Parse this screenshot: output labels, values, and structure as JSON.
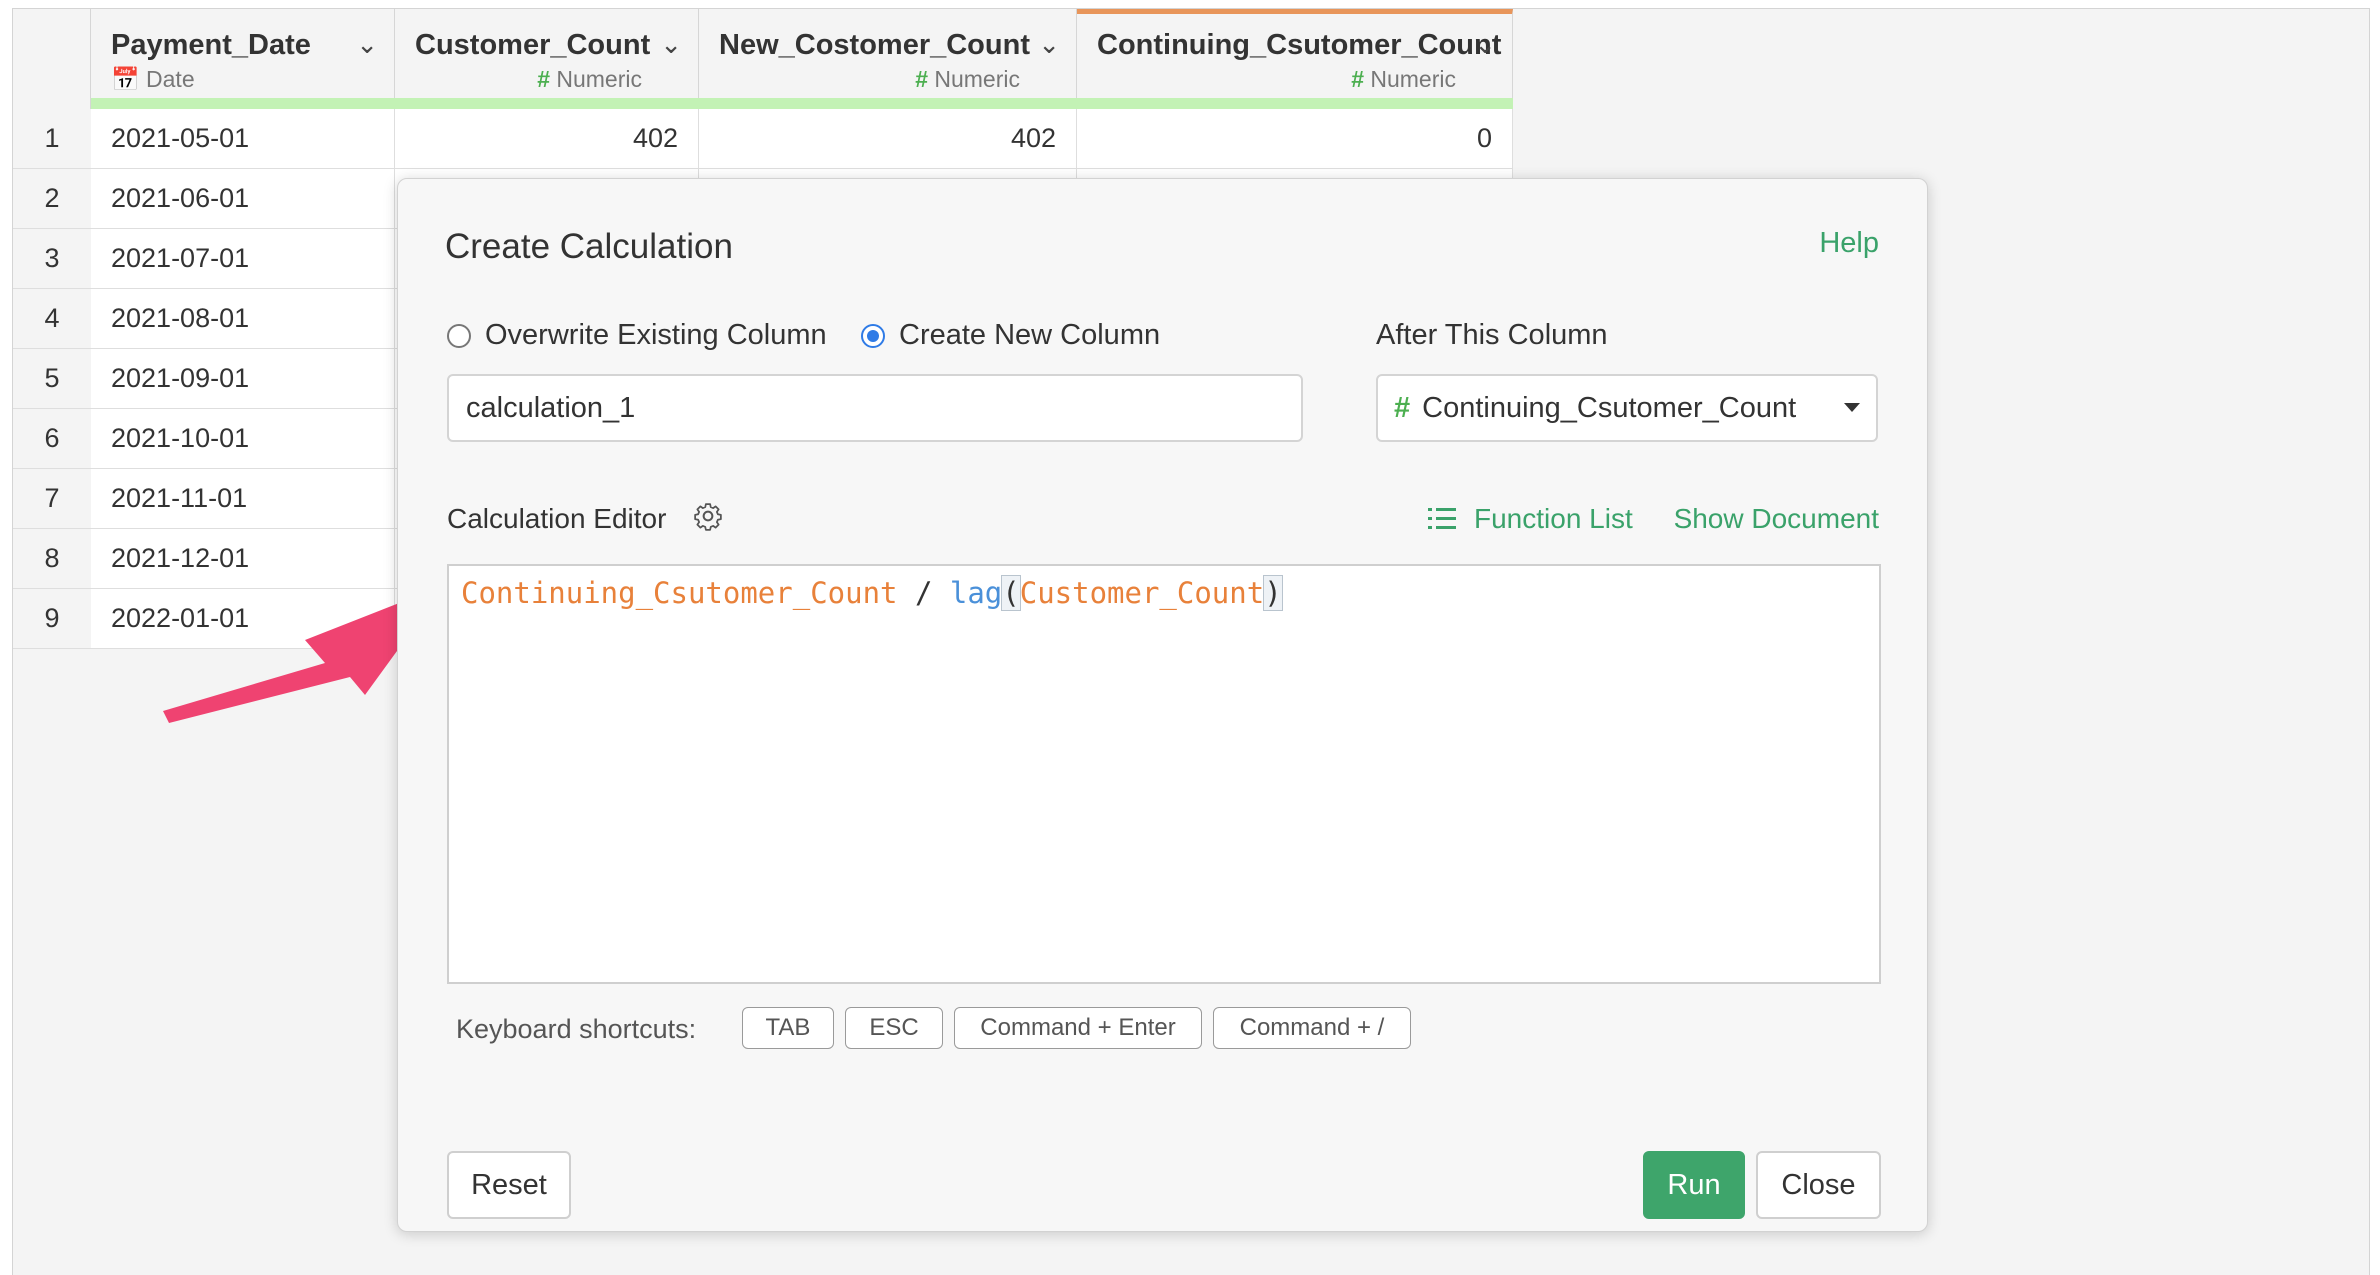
{
  "grid": {
    "columns": [
      {
        "name": "Payment_Date",
        "type": "Date"
      },
      {
        "name": "Customer_Count",
        "type": "Numeric"
      },
      {
        "name": "New_Costomer_Count",
        "type": "Numeric"
      },
      {
        "name": "Continuing_Csutomer_Count",
        "type": "Numeric"
      }
    ],
    "rows": [
      {
        "num": "1",
        "date": "2021-05-01",
        "c1": "402",
        "c2": "402",
        "c3": "0"
      },
      {
        "num": "2",
        "date": "2021-06-01"
      },
      {
        "num": "3",
        "date": "2021-07-01"
      },
      {
        "num": "4",
        "date": "2021-08-01"
      },
      {
        "num": "5",
        "date": "2021-09-01"
      },
      {
        "num": "6",
        "date": "2021-10-01"
      },
      {
        "num": "7",
        "date": "2021-11-01"
      },
      {
        "num": "8",
        "date": "2021-12-01"
      },
      {
        "num": "9",
        "date": "2022-01-01"
      }
    ]
  },
  "modal": {
    "title": "Create Calculation",
    "help": "Help",
    "radio_overwrite": "Overwrite Existing Column",
    "radio_create": "Create New Column",
    "after_label": "After This Column",
    "name_value": "calculation_1",
    "after_value": "Continuing_Csutomer_Count",
    "editor_label": "Calculation Editor",
    "function_list": "Function List",
    "show_document": "Show Document",
    "code": {
      "col1": "Continuing_Csutomer_Count",
      "op": " / ",
      "fn": "lag",
      "open": "(",
      "col2": "Customer_Count",
      "close": ")"
    },
    "shortcuts_label": "Keyboard shortcuts:",
    "shortcuts": [
      "TAB",
      "ESC",
      "Command + Enter",
      "Command + /"
    ],
    "reset": "Reset",
    "run": "Run",
    "close": "Close"
  },
  "colors": {
    "accent_green": "#3ea56b",
    "header_bar": "#c3f2b5",
    "active_column": "#e8955a",
    "arrow": "#ef4371",
    "token_column": "#e8813a",
    "token_function": "#4a90d9"
  }
}
